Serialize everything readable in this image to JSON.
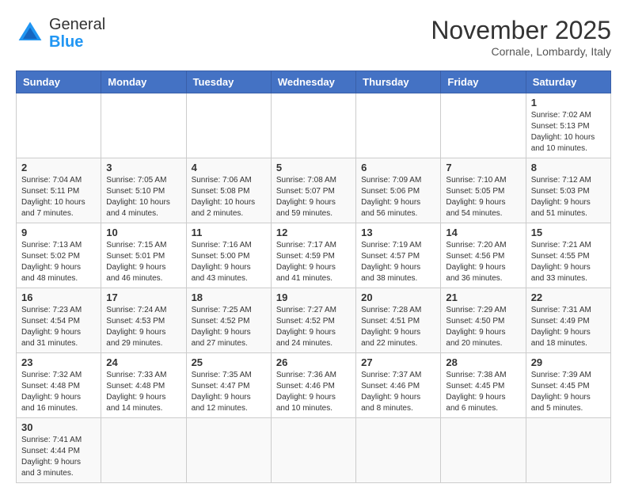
{
  "header": {
    "logo_general": "General",
    "logo_blue": "Blue",
    "month_year": "November 2025",
    "location": "Cornale, Lombardy, Italy"
  },
  "weekdays": [
    "Sunday",
    "Monday",
    "Tuesday",
    "Wednesday",
    "Thursday",
    "Friday",
    "Saturday"
  ],
  "weeks": [
    [
      {
        "day": "",
        "info": ""
      },
      {
        "day": "",
        "info": ""
      },
      {
        "day": "",
        "info": ""
      },
      {
        "day": "",
        "info": ""
      },
      {
        "day": "",
        "info": ""
      },
      {
        "day": "",
        "info": ""
      },
      {
        "day": "1",
        "info": "Sunrise: 7:02 AM\nSunset: 5:13 PM\nDaylight: 10 hours and 10 minutes."
      }
    ],
    [
      {
        "day": "2",
        "info": "Sunrise: 7:04 AM\nSunset: 5:11 PM\nDaylight: 10 hours and 7 minutes."
      },
      {
        "day": "3",
        "info": "Sunrise: 7:05 AM\nSunset: 5:10 PM\nDaylight: 10 hours and 4 minutes."
      },
      {
        "day": "4",
        "info": "Sunrise: 7:06 AM\nSunset: 5:08 PM\nDaylight: 10 hours and 2 minutes."
      },
      {
        "day": "5",
        "info": "Sunrise: 7:08 AM\nSunset: 5:07 PM\nDaylight: 9 hours and 59 minutes."
      },
      {
        "day": "6",
        "info": "Sunrise: 7:09 AM\nSunset: 5:06 PM\nDaylight: 9 hours and 56 minutes."
      },
      {
        "day": "7",
        "info": "Sunrise: 7:10 AM\nSunset: 5:05 PM\nDaylight: 9 hours and 54 minutes."
      },
      {
        "day": "8",
        "info": "Sunrise: 7:12 AM\nSunset: 5:03 PM\nDaylight: 9 hours and 51 minutes."
      }
    ],
    [
      {
        "day": "9",
        "info": "Sunrise: 7:13 AM\nSunset: 5:02 PM\nDaylight: 9 hours and 48 minutes."
      },
      {
        "day": "10",
        "info": "Sunrise: 7:15 AM\nSunset: 5:01 PM\nDaylight: 9 hours and 46 minutes."
      },
      {
        "day": "11",
        "info": "Sunrise: 7:16 AM\nSunset: 5:00 PM\nDaylight: 9 hours and 43 minutes."
      },
      {
        "day": "12",
        "info": "Sunrise: 7:17 AM\nSunset: 4:59 PM\nDaylight: 9 hours and 41 minutes."
      },
      {
        "day": "13",
        "info": "Sunrise: 7:19 AM\nSunset: 4:57 PM\nDaylight: 9 hours and 38 minutes."
      },
      {
        "day": "14",
        "info": "Sunrise: 7:20 AM\nSunset: 4:56 PM\nDaylight: 9 hours and 36 minutes."
      },
      {
        "day": "15",
        "info": "Sunrise: 7:21 AM\nSunset: 4:55 PM\nDaylight: 9 hours and 33 minutes."
      }
    ],
    [
      {
        "day": "16",
        "info": "Sunrise: 7:23 AM\nSunset: 4:54 PM\nDaylight: 9 hours and 31 minutes."
      },
      {
        "day": "17",
        "info": "Sunrise: 7:24 AM\nSunset: 4:53 PM\nDaylight: 9 hours and 29 minutes."
      },
      {
        "day": "18",
        "info": "Sunrise: 7:25 AM\nSunset: 4:52 PM\nDaylight: 9 hours and 27 minutes."
      },
      {
        "day": "19",
        "info": "Sunrise: 7:27 AM\nSunset: 4:52 PM\nDaylight: 9 hours and 24 minutes."
      },
      {
        "day": "20",
        "info": "Sunrise: 7:28 AM\nSunset: 4:51 PM\nDaylight: 9 hours and 22 minutes."
      },
      {
        "day": "21",
        "info": "Sunrise: 7:29 AM\nSunset: 4:50 PM\nDaylight: 9 hours and 20 minutes."
      },
      {
        "day": "22",
        "info": "Sunrise: 7:31 AM\nSunset: 4:49 PM\nDaylight: 9 hours and 18 minutes."
      }
    ],
    [
      {
        "day": "23",
        "info": "Sunrise: 7:32 AM\nSunset: 4:48 PM\nDaylight: 9 hours and 16 minutes."
      },
      {
        "day": "24",
        "info": "Sunrise: 7:33 AM\nSunset: 4:48 PM\nDaylight: 9 hours and 14 minutes."
      },
      {
        "day": "25",
        "info": "Sunrise: 7:35 AM\nSunset: 4:47 PM\nDaylight: 9 hours and 12 minutes."
      },
      {
        "day": "26",
        "info": "Sunrise: 7:36 AM\nSunset: 4:46 PM\nDaylight: 9 hours and 10 minutes."
      },
      {
        "day": "27",
        "info": "Sunrise: 7:37 AM\nSunset: 4:46 PM\nDaylight: 9 hours and 8 minutes."
      },
      {
        "day": "28",
        "info": "Sunrise: 7:38 AM\nSunset: 4:45 PM\nDaylight: 9 hours and 6 minutes."
      },
      {
        "day": "29",
        "info": "Sunrise: 7:39 AM\nSunset: 4:45 PM\nDaylight: 9 hours and 5 minutes."
      }
    ],
    [
      {
        "day": "30",
        "info": "Sunrise: 7:41 AM\nSunset: 4:44 PM\nDaylight: 9 hours and 3 minutes."
      },
      {
        "day": "",
        "info": ""
      },
      {
        "day": "",
        "info": ""
      },
      {
        "day": "",
        "info": ""
      },
      {
        "day": "",
        "info": ""
      },
      {
        "day": "",
        "info": ""
      },
      {
        "day": "",
        "info": ""
      }
    ]
  ]
}
